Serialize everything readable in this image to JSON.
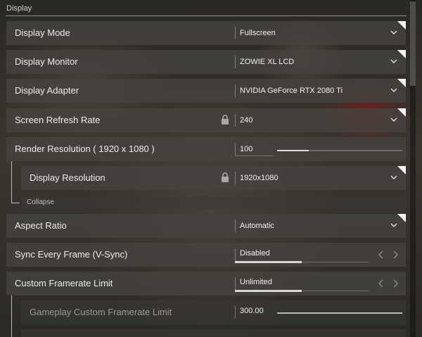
{
  "section": {
    "title": "Display"
  },
  "settings": {
    "display_mode": {
      "label": "Display Mode",
      "value": "Fullscreen"
    },
    "display_monitor": {
      "label": "Display Monitor",
      "value": "ZOWIE XL LCD"
    },
    "display_adapter": {
      "label": "Display Adapter",
      "value": "NVIDIA GeForce RTX 2080 Ti"
    },
    "refresh_rate": {
      "label": "Screen Refresh Rate",
      "value": "240",
      "locked": true
    },
    "render_resolution": {
      "label": "Render Resolution ( 1920 x 1080 )",
      "value": "100",
      "slider_fraction": 0.25
    },
    "display_resolution": {
      "label": "Display Resolution",
      "value": "1920x1080",
      "locked": true
    },
    "collapse": {
      "label": "Collapse"
    },
    "aspect_ratio": {
      "label": "Aspect Ratio",
      "value": "Automatic"
    },
    "vsync": {
      "label": "Sync Every Frame (V-Sync)",
      "value": "Disabled",
      "option_fraction": 0.5
    },
    "framerate_limit": {
      "label": "Custom Framerate Limit",
      "value": "Unlimited",
      "option_fraction": 0.5
    },
    "gameplay_framerate": {
      "label": "Gameplay Custom Framerate Limit",
      "value": "300.00",
      "slider_fraction": 1.0
    }
  },
  "icons": {
    "dropdown": "chevron-down-icon",
    "lock": "lock-icon",
    "prev": "chevron-left-icon",
    "next": "chevron-right-icon"
  }
}
